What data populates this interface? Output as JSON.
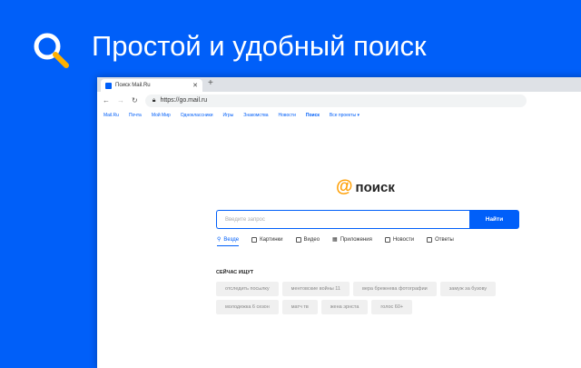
{
  "hero": {
    "title": "Простой и удобный поиск",
    "icon": "search-icon"
  },
  "browser": {
    "tab_title": "Поиск Mail.Ru",
    "url": "https://go.mail.ru"
  },
  "nav_links": [
    "Mail.Ru",
    "Почта",
    "Мой Мир",
    "Одноклассники",
    "Игры",
    "Знакомства",
    "Новости",
    "Поиск",
    "Все проекты ▾"
  ],
  "logo": {
    "at": "@",
    "text": "поиск"
  },
  "search": {
    "placeholder": "Введите запрос",
    "button": "Найти"
  },
  "search_tabs": [
    "Везде",
    "Картинки",
    "Видео",
    "Приложения",
    "Новости",
    "Ответы"
  ],
  "trending": {
    "heading": "СЕЙЧАС ИЩУТ",
    "items": [
      "отследить посылку",
      "ментовские войны 11",
      "вера брежнева фотографии",
      "замуж за бузову",
      "молодежка 6 сезон",
      "матч тв",
      "жена эрнста",
      "голос 60+"
    ]
  },
  "colors": {
    "brand": "#005ff9",
    "accent": "#ff9e00"
  }
}
